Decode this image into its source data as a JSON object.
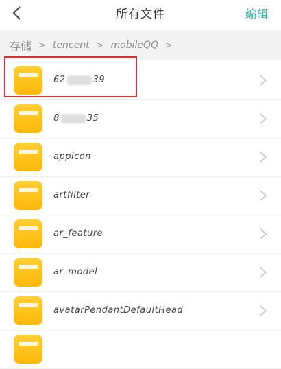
{
  "header": {
    "title": "所有文件",
    "edit_label": "编辑"
  },
  "breadcrumb": {
    "root": "存储",
    "sep": ">",
    "items": [
      "tencent",
      "mobileQQ"
    ],
    "trailing_sep": ">"
  },
  "files": [
    {
      "prefix": "62",
      "suffix": "39"
    },
    {
      "prefix": "8",
      "suffix": "35"
    },
    {
      "name": "appicon"
    },
    {
      "name": "artfilter"
    },
    {
      "name": "ar_feature"
    },
    {
      "name": "ar_model"
    },
    {
      "name": "avatarPendantDefaultHead"
    },
    {
      "name": ""
    }
  ],
  "colors": {
    "accent": "#2eaf8f",
    "folder": "#ffc31f",
    "highlight": "#d8322f"
  }
}
